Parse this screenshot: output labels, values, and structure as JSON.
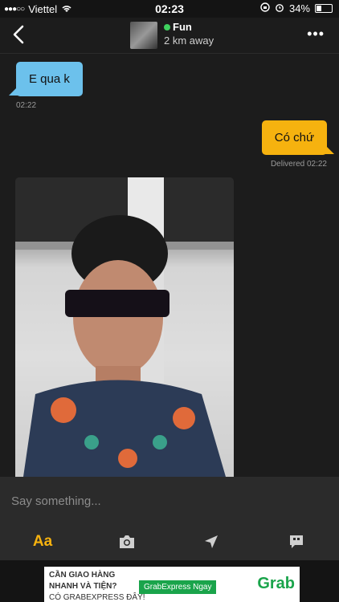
{
  "status_bar": {
    "carrier": "Viettel",
    "signal": "●●●○○",
    "time": "02:23",
    "battery_pct": "34%",
    "battery_level": 0.34
  },
  "header": {
    "name": "Fun",
    "distance": "2 km away",
    "online_color": "#3fd15e"
  },
  "messages": [
    {
      "direction": "in",
      "text": "E qua k",
      "time": "02:22"
    },
    {
      "direction": "out",
      "text": "Có chứ",
      "status": "Delivered 02:22"
    }
  ],
  "composer": {
    "placeholder": "Say something...",
    "tools": [
      {
        "label": "Aa",
        "icon": "text-format-icon"
      },
      {
        "icon": "camera-icon"
      },
      {
        "icon": "location-arrow-icon"
      },
      {
        "icon": "quote-bubble-icon"
      }
    ]
  },
  "ad": {
    "line1": "CẦN GIAO HÀNG",
    "line2": "NHANH VÀ TIỆN?",
    "line3": "CÓ GRABEXPRESS ĐÂY!",
    "button": "GrabExpress Ngay",
    "brand": "Grab"
  },
  "colors": {
    "incoming_bubble": "#6cc1ec",
    "outgoing_bubble": "#f6b20f",
    "background": "#1c1c1c"
  }
}
